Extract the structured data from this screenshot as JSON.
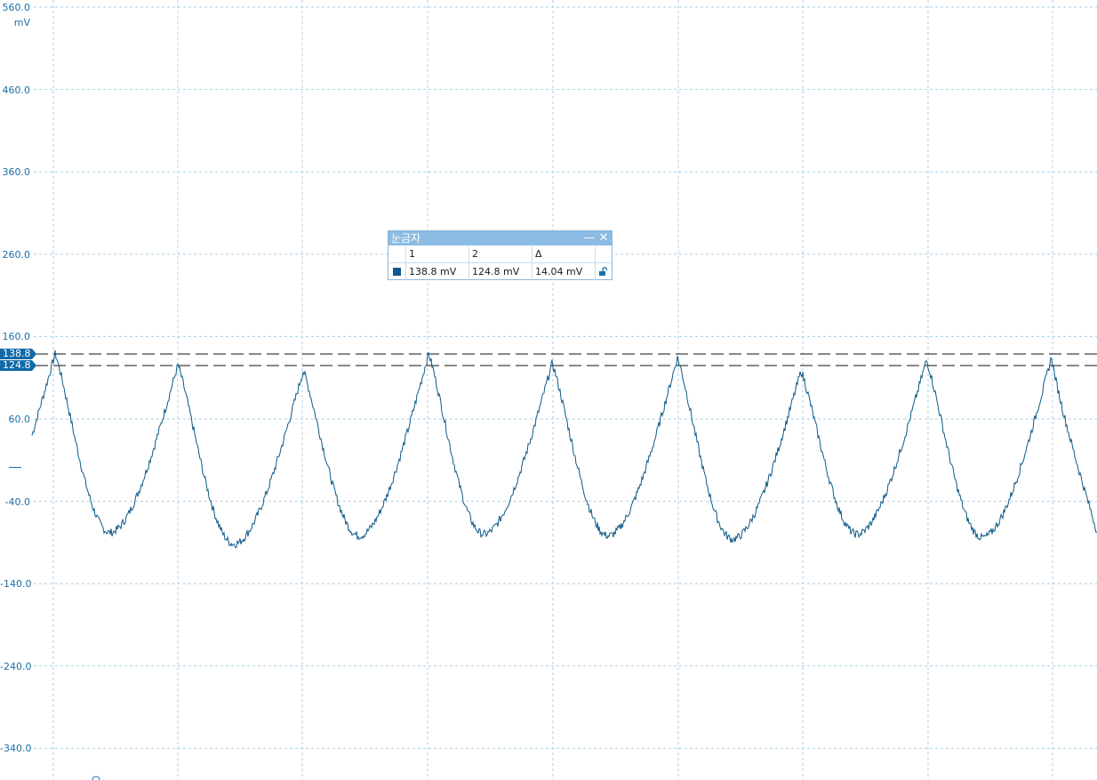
{
  "axis": {
    "y_ticks": [
      "560.0",
      "460.0",
      "360.0",
      "260.0",
      "160.0",
      "60.0",
      "-40.0",
      "-140.0",
      "-240.0",
      "-340.0"
    ],
    "unit": "mV"
  },
  "rulers": [
    {
      "label": "138.8",
      "value": 138.8
    },
    {
      "label": "124.8",
      "value": 124.8
    }
  ],
  "ruler_panel": {
    "title": "눈금자",
    "minimize_glyph": "—",
    "close_glyph": "✕",
    "headers": [
      "1",
      "2",
      "Δ"
    ],
    "values": [
      "138.8 mV",
      "124.8 mV",
      "14.04 mV"
    ],
    "lock_icon": "unlock-icon"
  },
  "colors": {
    "trace": "#0d5a88",
    "grid": "#a9cfe6",
    "accent": "#0f6aa8",
    "axis_text": "#1b6fa8"
  },
  "chart_data": {
    "type": "line",
    "ylim": [
      -360,
      560
    ],
    "ylabel": "mV",
    "grid": true,
    "series": [
      {
        "color": "#0d5a88",
        "waveform": "periodic peaks",
        "peaks_mV": [
          138.8,
          125,
          118,
          139,
          127,
          134,
          118,
          131,
          135
        ],
        "troughs_mV": [
          -78,
          -92,
          -82,
          -80,
          -82,
          -86,
          -80,
          -84,
          -80
        ]
      }
    ]
  }
}
